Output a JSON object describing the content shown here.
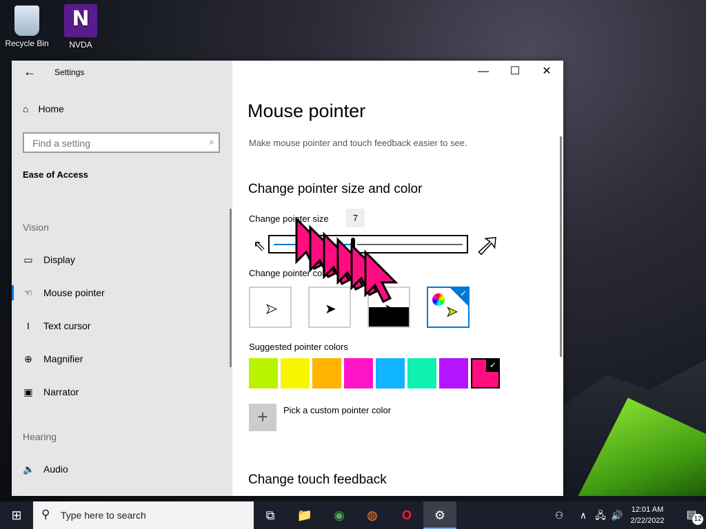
{
  "desktop": {
    "icons": [
      {
        "label": "Recycle Bin",
        "icon": "recycle-bin-icon"
      },
      {
        "label": "NVDA",
        "icon": "nvda-icon",
        "glyph": "N"
      }
    ]
  },
  "window": {
    "title": "Settings",
    "back_icon": "←",
    "minimize": "—",
    "maximize": "☐",
    "close": "✕"
  },
  "sidebar": {
    "home_label": "Home",
    "home_icon": "⌂",
    "search_placeholder": "Find a setting",
    "search_icon": "⌕",
    "category": "Ease of Access",
    "vision_label": "Vision",
    "hearing_label": "Hearing",
    "items": [
      {
        "label": "Display",
        "icon": "▭"
      },
      {
        "label": "Mouse pointer",
        "icon": "☜"
      },
      {
        "label": "Text cursor",
        "icon": "I"
      },
      {
        "label": "Magnifier",
        "icon": "⊕"
      },
      {
        "label": "Narrator",
        "icon": "▣"
      },
      {
        "label": "Audio",
        "icon": "🔈"
      }
    ],
    "active_item": "Mouse pointer"
  },
  "main": {
    "title": "Mouse pointer",
    "description": "Make mouse pointer and touch feedback easier to see.",
    "section_pointer": "Change pointer size and color",
    "size_label": "Change pointer size",
    "size_value": "7",
    "size_fraction": 0.42,
    "color_label": "Change pointer color",
    "color_options": [
      {
        "name": "white",
        "selected": false
      },
      {
        "name": "black",
        "selected": false
      },
      {
        "name": "inverted",
        "selected": false
      },
      {
        "name": "custom",
        "selected": true
      }
    ],
    "suggested_label": "Suggested pointer colors",
    "swatches": [
      "#b8f400",
      "#f6f600",
      "#ffb400",
      "#ff14c8",
      "#10b4ff",
      "#10f0b0",
      "#b414ff",
      "#ff0d7e"
    ],
    "selected_swatch": 7,
    "check_mark": "✓",
    "custom_plus": "+",
    "custom_label": "Pick a custom pointer color",
    "section_touch": "Change touch feedback"
  },
  "taskbar": {
    "start_icon": "⊞",
    "search_icon": "⚲",
    "search_placeholder": "Type here to search",
    "apps": [
      {
        "name": "task-view",
        "glyph": "⧉"
      },
      {
        "name": "file-explorer",
        "glyph": "📁"
      },
      {
        "name": "chrome",
        "glyph": "◉"
      },
      {
        "name": "firefox",
        "glyph": "◍"
      },
      {
        "name": "opera",
        "glyph": "O"
      },
      {
        "name": "settings",
        "glyph": "⚙"
      }
    ],
    "tray_people": "⚇",
    "tray_chevron": "∧",
    "tray_network": "🖧",
    "tray_volume": "🔊",
    "time": "12:01 AM",
    "date": "2/22/2022",
    "notification_icon": "▤",
    "notification_count": "12"
  },
  "colors": {
    "accent": "#0078d7",
    "pointer_color": "#ff0d7e"
  }
}
